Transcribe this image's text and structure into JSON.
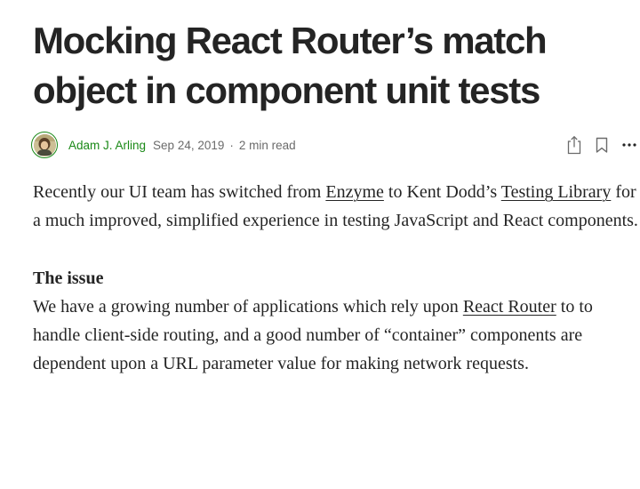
{
  "article": {
    "title": "Mocking React Router’s match object in component unit tests",
    "author": "Adam J. Arling",
    "date": "Sep 24, 2019",
    "separator": "·",
    "read_time": "2 min read",
    "icons": {
      "avatar": "author-avatar",
      "share": "share-icon",
      "bookmark": "bookmark-icon",
      "more": "more-options-icon"
    }
  },
  "paragraph1": {
    "t1": "Recently our UI team has switched from ",
    "link1": "Enzyme",
    "t2": " to Kent Dodd’s ",
    "link2": "Testing Library",
    "t3": " for a much improved, simplified experience in testing JavaScript and React components."
  },
  "section": {
    "heading": "The issue"
  },
  "paragraph2": {
    "t1": "We have a growing number of applications which rely upon ",
    "link1": "React Router",
    "t2": " to to handle client-side routing, and a good number of “container” components are dependent upon a URL parameter value for making network requests."
  },
  "colors": {
    "text": "#242424",
    "muted": "#6b6b6b",
    "author_green": "#1a8917"
  }
}
